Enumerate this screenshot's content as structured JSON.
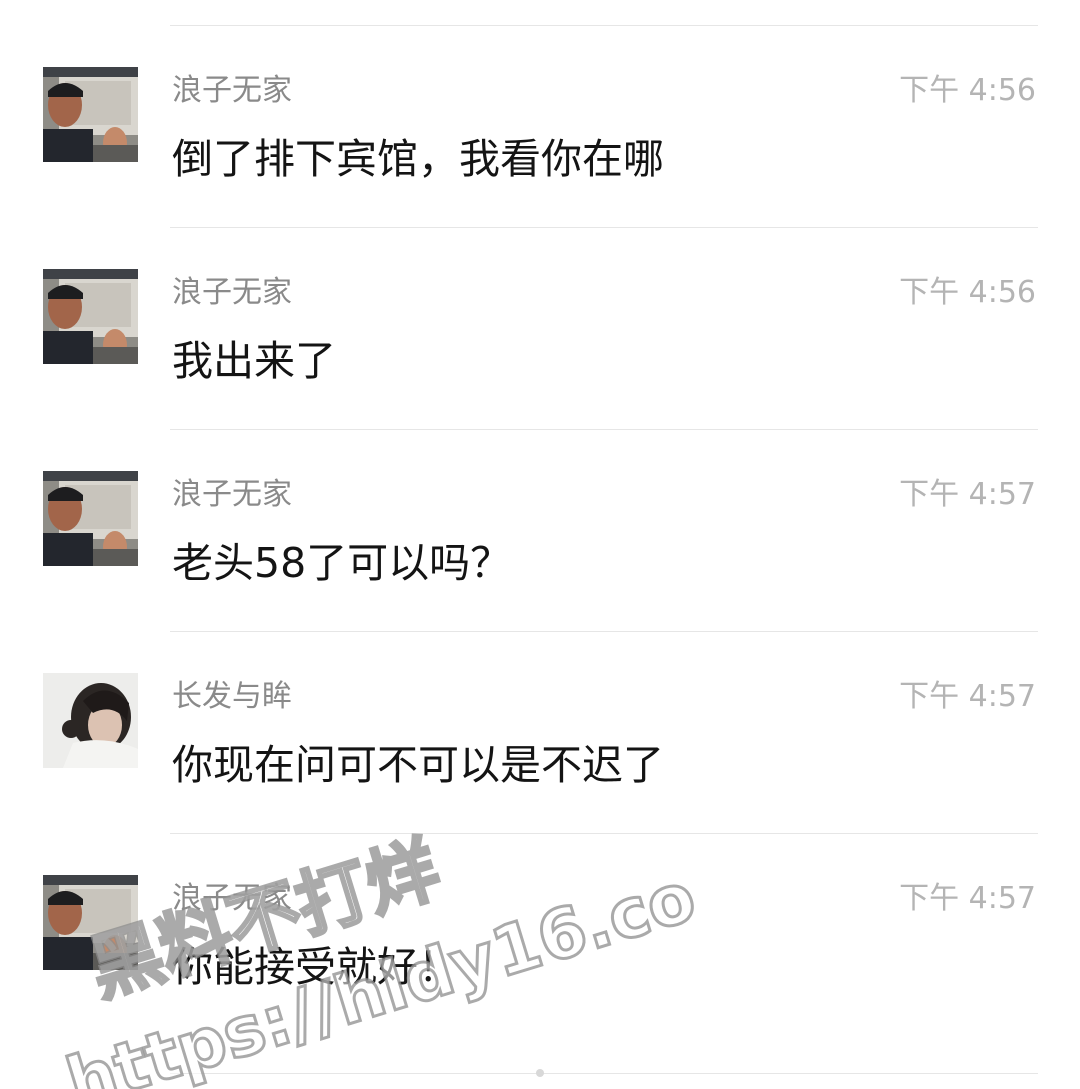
{
  "messages": [
    {
      "sender": "浪子无家",
      "time": "下午 4:56",
      "text": "倒了排下宾馆，我看你在哪",
      "avatar": "man-in-car-avatar"
    },
    {
      "sender": "浪子无家",
      "time": "下午 4:56",
      "text": "我出来了",
      "avatar": "man-in-car-avatar"
    },
    {
      "sender": "浪子无家",
      "time": "下午 4:57",
      "text": "老头58了可以吗？",
      "avatar": "man-in-car-avatar"
    },
    {
      "sender": "长发与眸",
      "time": "下午 4:57",
      "text": "你现在问可不可以是不迟了",
      "avatar": "woman-long-hair-avatar"
    },
    {
      "sender": "浪子无家",
      "time": "下午 4:57",
      "text": "你能接受就好！",
      "avatar": "man-in-car-avatar"
    }
  ],
  "watermark": {
    "line1": "黑料不打烊",
    "line2": "https://hldy16.co"
  },
  "colors": {
    "sender": "#8a8a8a",
    "time": "#b4b4b4",
    "text": "#141414",
    "divider": "#e6e6e6"
  }
}
